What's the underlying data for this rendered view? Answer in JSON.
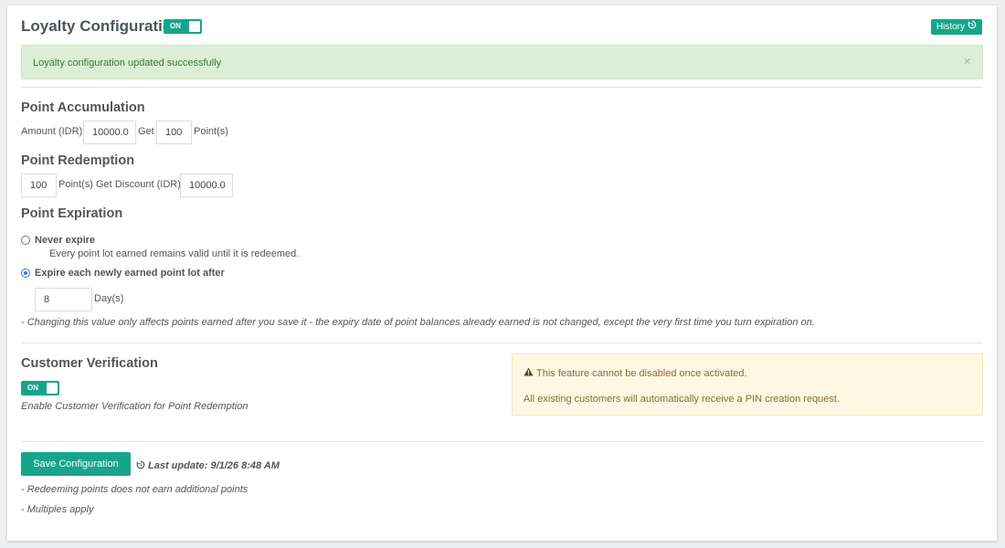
{
  "header": {
    "title": "Loyalty Configuration",
    "toggle_label": "ON",
    "history_label": "History"
  },
  "alert": {
    "message": "Loyalty configuration updated successfully",
    "close": "×"
  },
  "accumulation": {
    "title": "Point Accumulation",
    "amount_label": "Amount (IDR)",
    "amount_value": "10000.0",
    "get_label": "Get",
    "points_value": "100",
    "points_label": "Point(s)"
  },
  "redemption": {
    "title": "Point Redemption",
    "points_value": "100",
    "label": "Point(s) Get Discount (IDR)",
    "discount_value": "10000.0"
  },
  "expiration": {
    "title": "Point Expiration",
    "never_label": "Never expire",
    "never_desc": "Every point lot earned remains valid until it is redeemed.",
    "expire_label": "Expire each newly earned point lot after",
    "selected": "expire",
    "days_value": "8",
    "days_label": "Day(s)",
    "note": "- Changing this value only affects points earned after you save it - the expiry date of point balances already earned is not changed, except the very first time you turn expiration on."
  },
  "verification": {
    "title": "Customer Verification",
    "toggle_label": "ON",
    "desc": "Enable Customer Verification for Point Redemption",
    "warning_line1": "This feature cannot be disabled once activated.",
    "warning_line2": "All existing customers will automatically receive a PIN creation request."
  },
  "footer": {
    "save_label": "Save Configuration",
    "last_update": "Last update: 9/1/26 8:48 AM",
    "note1": "- Redeeming points does not earn additional points",
    "note2": "- Multiples apply"
  },
  "colors": {
    "accent": "#17a589",
    "success_bg": "#dcefd6",
    "warning_bg": "#fdf7e3",
    "radio_selected": "#2f7be0"
  },
  "icons": {
    "history": "history-icon",
    "warning": "warning-triangle-icon",
    "last_update": "history-icon"
  }
}
